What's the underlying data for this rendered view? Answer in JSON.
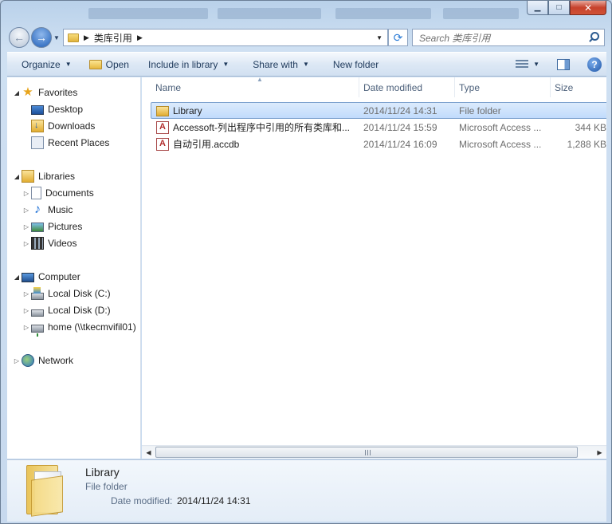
{
  "window": {
    "minimize": "▁",
    "maximize": "□",
    "close": "✕"
  },
  "address": {
    "path": [
      "类库引用"
    ],
    "search_placeholder": "Search 类库引用"
  },
  "toolbar": {
    "organize": "Organize",
    "open": "Open",
    "include_in_library": "Include in library",
    "share_with": "Share with",
    "new_folder": "New folder",
    "help": "?"
  },
  "navpane": {
    "favorites": "Favorites",
    "desktop": "Desktop",
    "downloads": "Downloads",
    "recent_places": "Recent Places",
    "libraries": "Libraries",
    "documents": "Documents",
    "music": "Music",
    "pictures": "Pictures",
    "videos": "Videos",
    "computer": "Computer",
    "local_c": "Local Disk (C:)",
    "local_d": "Local Disk (D:)",
    "home_share": "home (\\\\tkecmvifil01)",
    "network": "Network"
  },
  "columns": {
    "name": "Name",
    "date_modified": "Date modified",
    "type": "Type",
    "size": "Size"
  },
  "files": [
    {
      "name": "Library",
      "date": "2014/11/24 14:31",
      "type": "File folder",
      "size": "",
      "icon": "folder-icon"
    },
    {
      "name": "Accessoft-列出程序中引用的所有类库和...",
      "date": "2014/11/24 15:59",
      "type": "Microsoft Access ...",
      "size": "344 KB",
      "icon": "access-file-icon"
    },
    {
      "name": "自动引用.accdb",
      "date": "2014/11/24 16:09",
      "type": "Microsoft Access ...",
      "size": "1,288 KB",
      "icon": "access-file-icon"
    }
  ],
  "details": {
    "name": "Library",
    "type": "File folder",
    "modified_label": "Date modified:",
    "modified_value": "2014/11/24 14:31"
  }
}
